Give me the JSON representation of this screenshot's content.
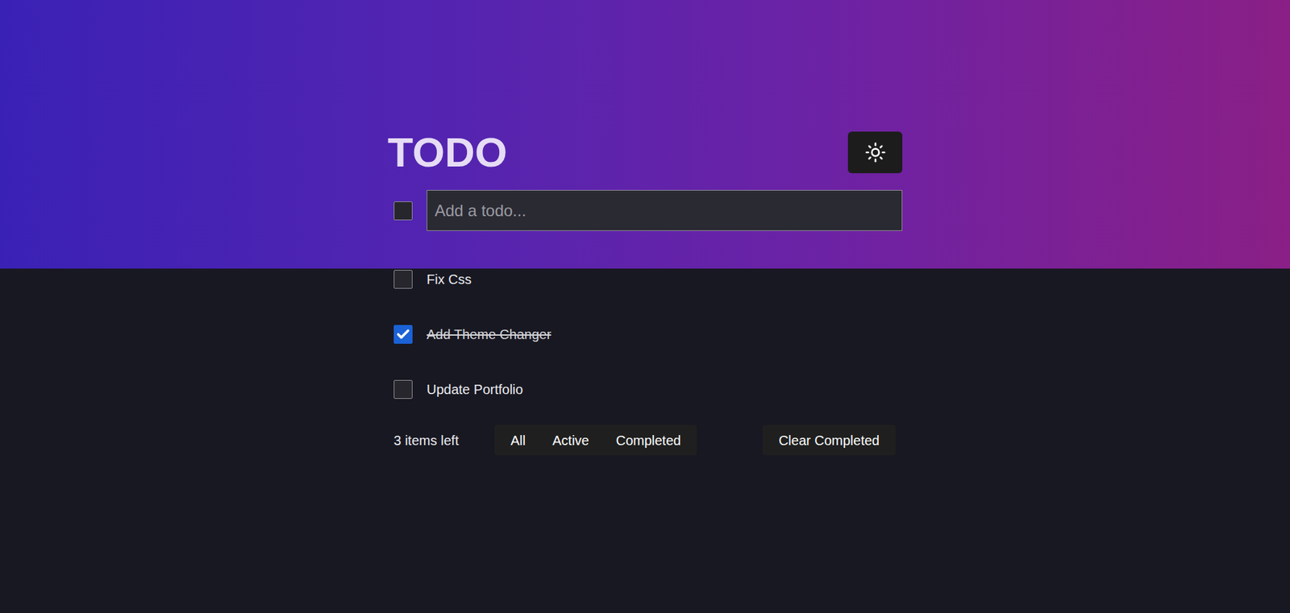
{
  "app": {
    "title": "TODO"
  },
  "new_todo": {
    "placeholder": "Add a todo...",
    "toggle_all_checked": false
  },
  "todos": [
    {
      "text": "Fix Css",
      "checked": false
    },
    {
      "text": "Add Theme Changer",
      "checked": true
    },
    {
      "text": "Update Portfolio",
      "checked": false
    }
  ],
  "footer": {
    "items_left": "3 items left",
    "filters": [
      {
        "label": "All",
        "selected": false
      },
      {
        "label": "Active",
        "selected": false
      },
      {
        "label": "Completed",
        "selected": false
      }
    ],
    "clear_button": "Clear Completed"
  }
}
